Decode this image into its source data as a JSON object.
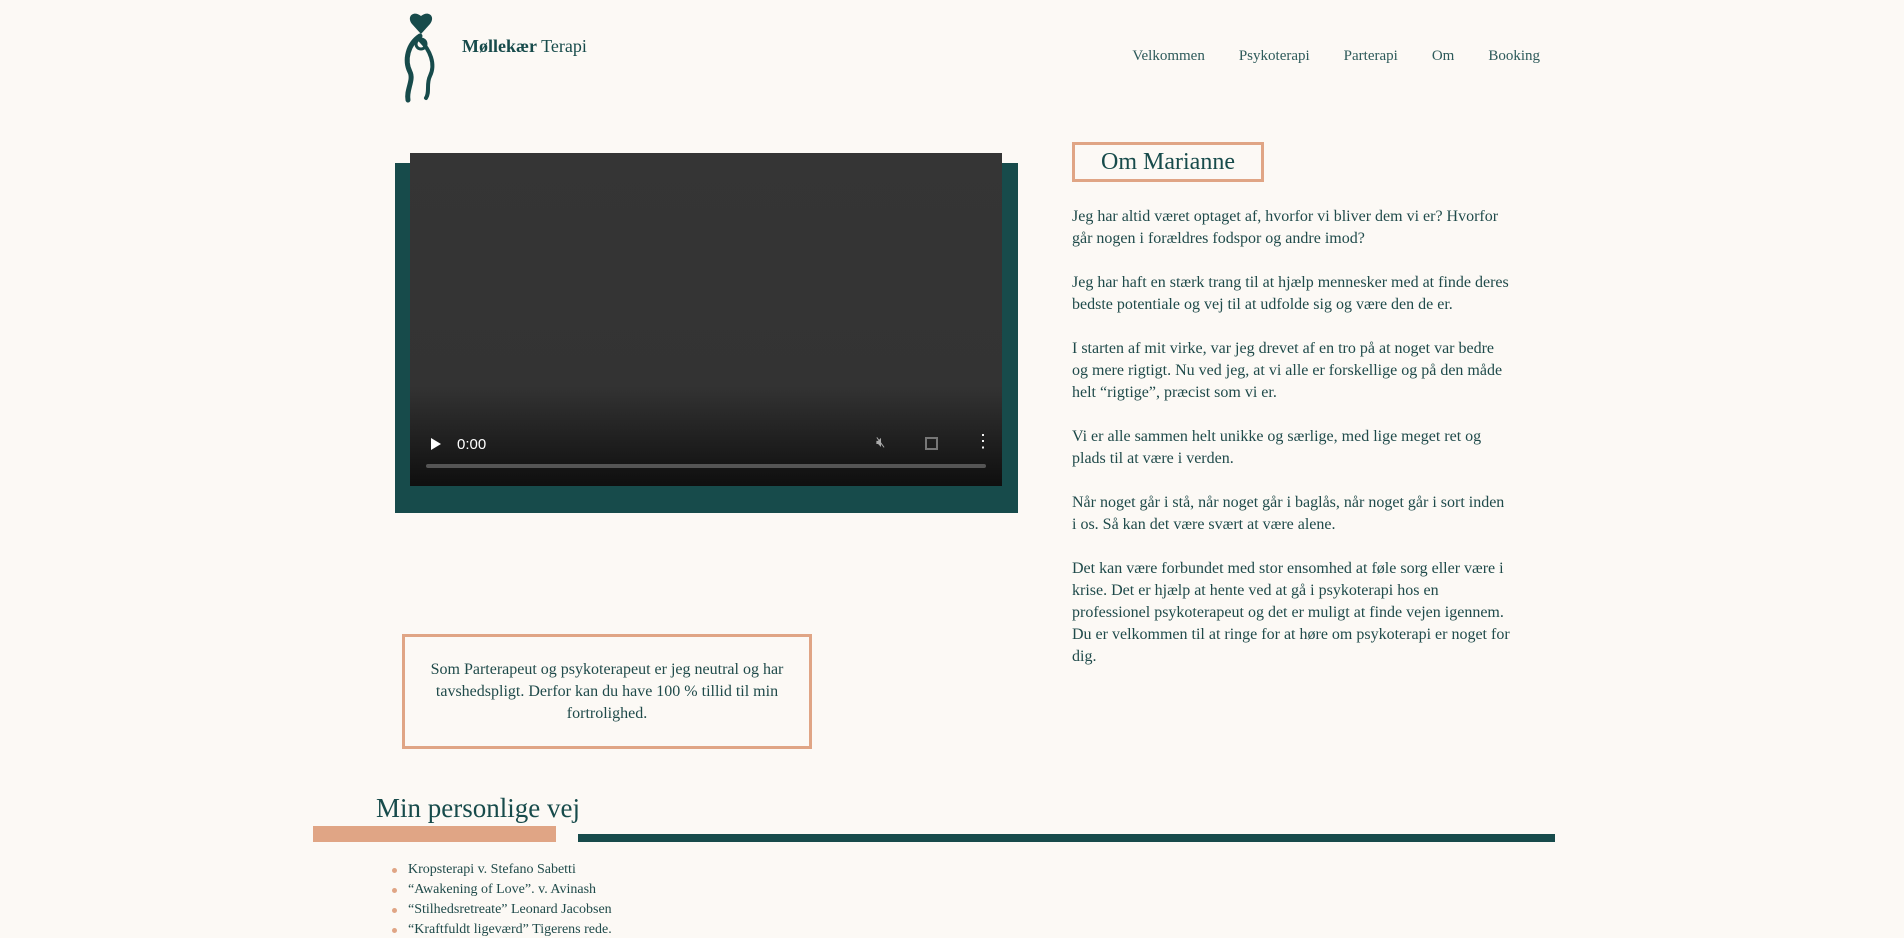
{
  "header": {
    "brand_bold": "Møllekær",
    "brand_regular": "Terapi",
    "nav": [
      "Velkommen",
      "Psykoterapi",
      "Parterapi",
      "Om",
      "Booking"
    ]
  },
  "video": {
    "time": "0:00"
  },
  "quote": "Som Parterapeut og psykoterapeut er jeg neutral og har tavshedspligt. Derfor kan du have 100 % tillid til min fortrolighed.",
  "about": {
    "title": "Om Marianne",
    "paragraphs": [
      "Jeg har altid været optaget af, hvorfor vi bliver dem vi er? Hvorfor går nogen i forældres fodspor og andre imod?",
      "Jeg har haft en stærk trang til at hjælp mennesker med at finde deres bedste potentiale og vej til at udfolde sig og være den de er.",
      "I starten af mit virke, var jeg drevet af en tro på at noget var bedre og mere rigtigt. Nu ved jeg, at vi alle er forskellige og på den måde helt “rigtige”, præcist som vi er.",
      "Vi er alle sammen helt unikke og særlige, med lige meget ret og plads til at være i verden.",
      "Når noget går i stå, når noget går i baglås, når noget går i sort inden i os. Så kan det være svært at være alene.",
      "Det kan være forbundet med stor ensomhed at føle sorg eller være i krise. Det er hjælp at hente ved at gå i psykoterapi hos en professionel psykoterapeut og det er muligt at finde vejen igennem. Du er velkommen til at ringe for at høre om psykoterapi er noget for dig."
    ]
  },
  "journey": {
    "title": "Min personlige vej",
    "items": [
      "Kropsterapi v. Stefano Sabetti",
      "“Awakening of Love”. v. Avinash",
      "“Stilhedsretreate” Leonard Jacobsen",
      "“Kraftfuldt ligeværd” Tigerens rede."
    ]
  },
  "colors": {
    "accent_green": "#174b4b",
    "accent_orange": "#e0a585",
    "background": "#fcf9f5"
  }
}
